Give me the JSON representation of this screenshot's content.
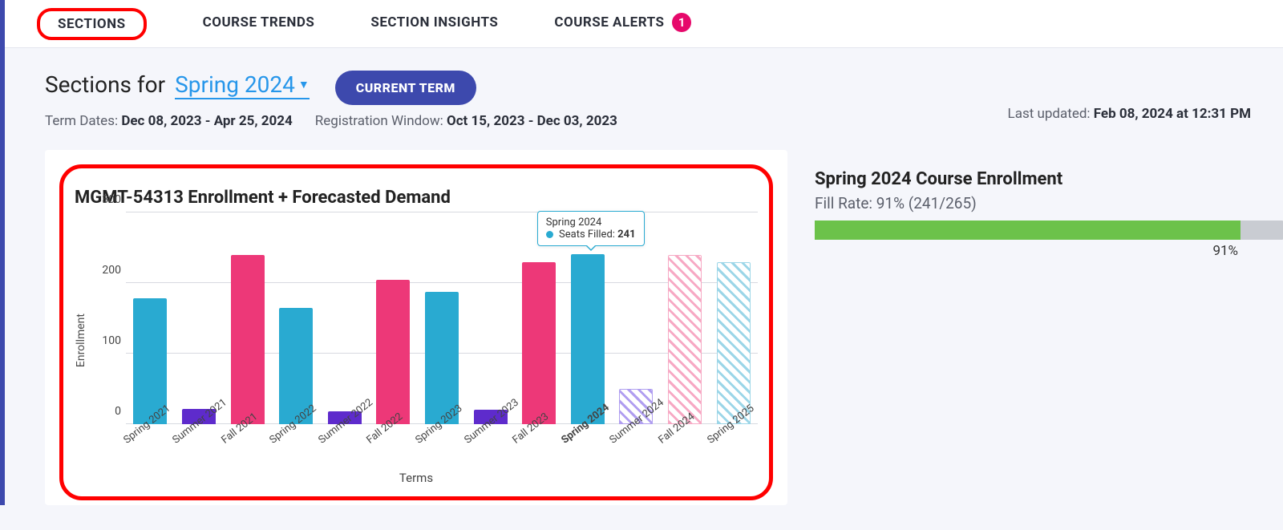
{
  "tabs": {
    "sections": "SECTIONS",
    "course_trends": "COURSE TRENDS",
    "section_insights": "SECTION INSIGHTS",
    "course_alerts": "COURSE ALERTS",
    "alerts_count": "1"
  },
  "header": {
    "prefix": "Sections for",
    "term": "Spring 2024",
    "pill": "CURRENT TERM",
    "term_dates_label": "Term Dates:",
    "term_dates": "Dec 08, 2023 - Apr 25, 2024",
    "reg_label": "Registration Window:",
    "reg_dates": "Oct 15, 2023 - Dec 03, 2023",
    "updated_label": "Last updated:",
    "updated": "Feb 08, 2024 at 12:31 PM"
  },
  "chart": {
    "title": "MGMT-54313 Enrollment + Forecasted Demand",
    "ylabel": "Enrollment",
    "xlabel": "Terms"
  },
  "tooltip": {
    "term": "Spring 2024",
    "series": "Seats Filled:",
    "value": "241"
  },
  "side": {
    "title": "Spring 2024 Course Enrollment",
    "fill_label": "Fill Rate: 91% (241/265)",
    "pct": "91%"
  },
  "chart_data": {
    "type": "bar",
    "title": "MGMT-54313 Enrollment + Forecasted Demand",
    "xlabel": "Terms",
    "ylabel": "Enrollment",
    "ylim": [
      0,
      300
    ],
    "yticks": [
      0,
      100,
      200,
      300
    ],
    "categories": [
      "Spring 2021",
      "Summer 2021",
      "Fall 2021",
      "Spring 2022",
      "Summer 2022",
      "Fall 2022",
      "Spring 2023",
      "Summer 2023",
      "Fall 2023",
      "Spring 2024",
      "Summer 2024",
      "Fall 2024",
      "Spring 2025"
    ],
    "values": [
      178,
      22,
      240,
      165,
      18,
      205,
      187,
      20,
      230,
      241,
      50,
      240,
      230
    ],
    "season": [
      "spring",
      "summer",
      "fall",
      "spring",
      "summer",
      "fall",
      "spring",
      "summer",
      "fall",
      "spring",
      "summer",
      "fall",
      "spring"
    ],
    "forecast": [
      false,
      false,
      false,
      false,
      false,
      false,
      false,
      false,
      false,
      false,
      true,
      true,
      true
    ],
    "highlight_index": 9,
    "colors": {
      "spring": "#29aad1",
      "summer": "#5e2bcc",
      "fall": "#ed3878",
      "spring_forecast": "#9cd6e8",
      "summer_forecast": "#b09ef0",
      "fall_forecast": "#f7a9c4"
    }
  },
  "fill_rate": {
    "filled": 241,
    "capacity": 265,
    "pct": 91
  }
}
